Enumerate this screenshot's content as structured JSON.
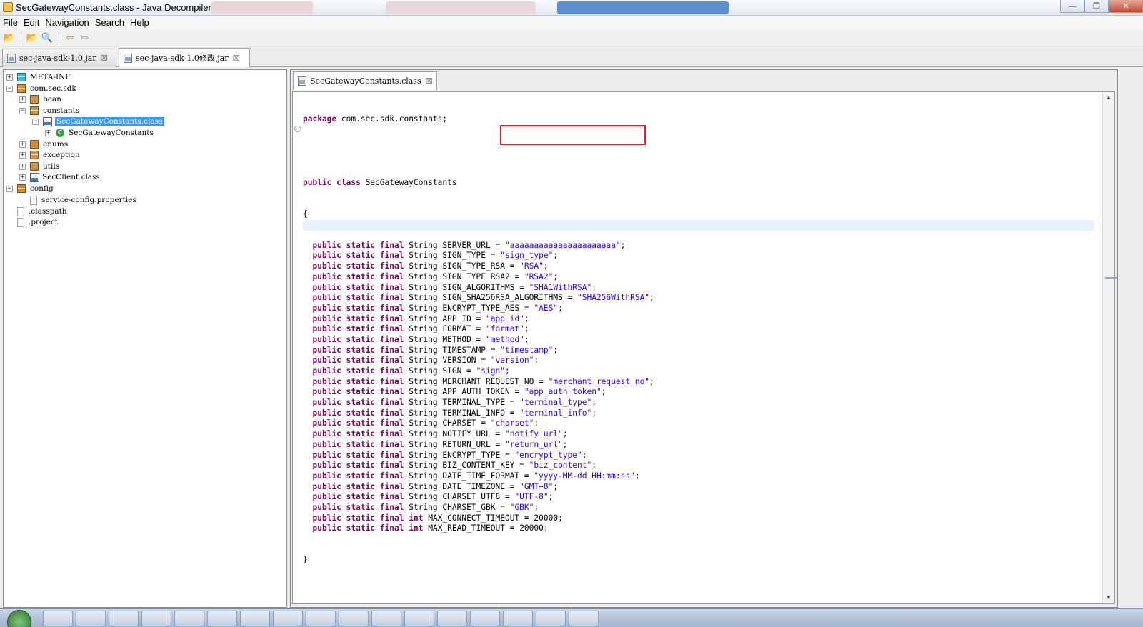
{
  "window": {
    "title": "SecGatewayConstants.class - Java Decompiler",
    "min_glyph": "—",
    "max_glyph": "❐",
    "close_glyph": "✕"
  },
  "menu": [
    "File",
    "Edit",
    "Navigation",
    "Search",
    "Help"
  ],
  "toolbar": {
    "open_icon": "📂",
    "open_type_icon": "📂",
    "search_icon": "🔍",
    "back_icon": "⇦",
    "forward_icon": "⇨"
  },
  "outer_tabs": [
    {
      "label": "sec-java-sdk-1.0.jar",
      "close": "☒"
    },
    {
      "label": "sec-java-sdk-1.0修改.jar",
      "close": "☒"
    }
  ],
  "tree": {
    "meta_inf": "META-INF",
    "com_sec_sdk": "com.sec.sdk",
    "bean": "bean",
    "constants": "constants",
    "selected_class": "SecGatewayConstants.class",
    "class_node": "SecGatewayConstants",
    "class_badge": "C",
    "enums": "enums",
    "exception": "exception",
    "utils": "utils",
    "secclient": "SecClient.class",
    "config": "config",
    "service_config": "service-config.properties",
    "classpath": ".classpath",
    "project": ".project",
    "plus": "+",
    "minus": "−"
  },
  "editor": {
    "tab_label": "SecGatewayConstants.class",
    "tab_close": "☒",
    "fold_glyph": "−",
    "scroll_up": "▲",
    "scroll_down": "▼"
  },
  "code": {
    "package_kw": "package",
    "package_name": " com.sec.sdk.constants;",
    "class_kw": "public class",
    "class_name": " SecGatewayConstants",
    "open_brace": "{",
    "close_brace": "}",
    "field_prefix": "public static final",
    "fields": [
      {
        "type": "String",
        "name": "SERVER_URL",
        "value": "\"aaaaaaaaaaaaaaaaaaaaaa\""
      },
      {
        "type": "String",
        "name": "SIGN_TYPE",
        "value": "\"sign_type\""
      },
      {
        "type": "String",
        "name": "SIGN_TYPE_RSA",
        "value": "\"RSA\""
      },
      {
        "type": "String",
        "name": "SIGN_TYPE_RSA2",
        "value": "\"RSA2\""
      },
      {
        "type": "String",
        "name": "SIGN_ALGORITHMS",
        "value": "\"SHA1WithRSA\""
      },
      {
        "type": "String",
        "name": "SIGN_SHA256RSA_ALGORITHMS",
        "value": "\"SHA256WithRSA\""
      },
      {
        "type": "String",
        "name": "ENCRYPT_TYPE_AES",
        "value": "\"AES\""
      },
      {
        "type": "String",
        "name": "APP_ID",
        "value": "\"app_id\""
      },
      {
        "type": "String",
        "name": "FORMAT",
        "value": "\"format\""
      },
      {
        "type": "String",
        "name": "METHOD",
        "value": "\"method\""
      },
      {
        "type": "String",
        "name": "TIMESTAMP",
        "value": "\"timestamp\""
      },
      {
        "type": "String",
        "name": "VERSION",
        "value": "\"version\""
      },
      {
        "type": "String",
        "name": "SIGN",
        "value": "\"sign\""
      },
      {
        "type": "String",
        "name": "MERCHANT_REQUEST_NO",
        "value": "\"merchant_request_no\""
      },
      {
        "type": "String",
        "name": "APP_AUTH_TOKEN",
        "value": "\"app_auth_token\""
      },
      {
        "type": "String",
        "name": "TERMINAL_TYPE",
        "value": "\"terminal_type\""
      },
      {
        "type": "String",
        "name": "TERMINAL_INFO",
        "value": "\"terminal_info\""
      },
      {
        "type": "String",
        "name": "CHARSET",
        "value": "\"charset\""
      },
      {
        "type": "String",
        "name": "NOTIFY_URL",
        "value": "\"notify_url\""
      },
      {
        "type": "String",
        "name": "RETURN_URL",
        "value": "\"return_url\""
      },
      {
        "type": "String",
        "name": "ENCRYPT_TYPE",
        "value": "\"encrypt_type\""
      },
      {
        "type": "String",
        "name": "BIZ_CONTENT_KEY",
        "value": "\"biz_content\""
      },
      {
        "type": "String",
        "name": "DATE_TIME_FORMAT",
        "value": "\"yyyy-MM-dd HH:mm:ss\""
      },
      {
        "type": "String",
        "name": "DATE_TIMEZONE",
        "value": "\"GMT+8\""
      },
      {
        "type": "String",
        "name": "CHARSET_UTF8",
        "value": "\"UTF-8\""
      },
      {
        "type": "String",
        "name": "CHARSET_GBK",
        "value": "\"GBK\""
      },
      {
        "type": "int",
        "name": "MAX_CONNECT_TIMEOUT",
        "value": "20000"
      },
      {
        "type": "int",
        "name": "MAX_READ_TIMEOUT",
        "value": "20000"
      }
    ]
  },
  "colors": {
    "keyword": "#7f0055",
    "string": "#2a00ff",
    "selection": "#3399ff",
    "highlight_box": "#e02020"
  }
}
